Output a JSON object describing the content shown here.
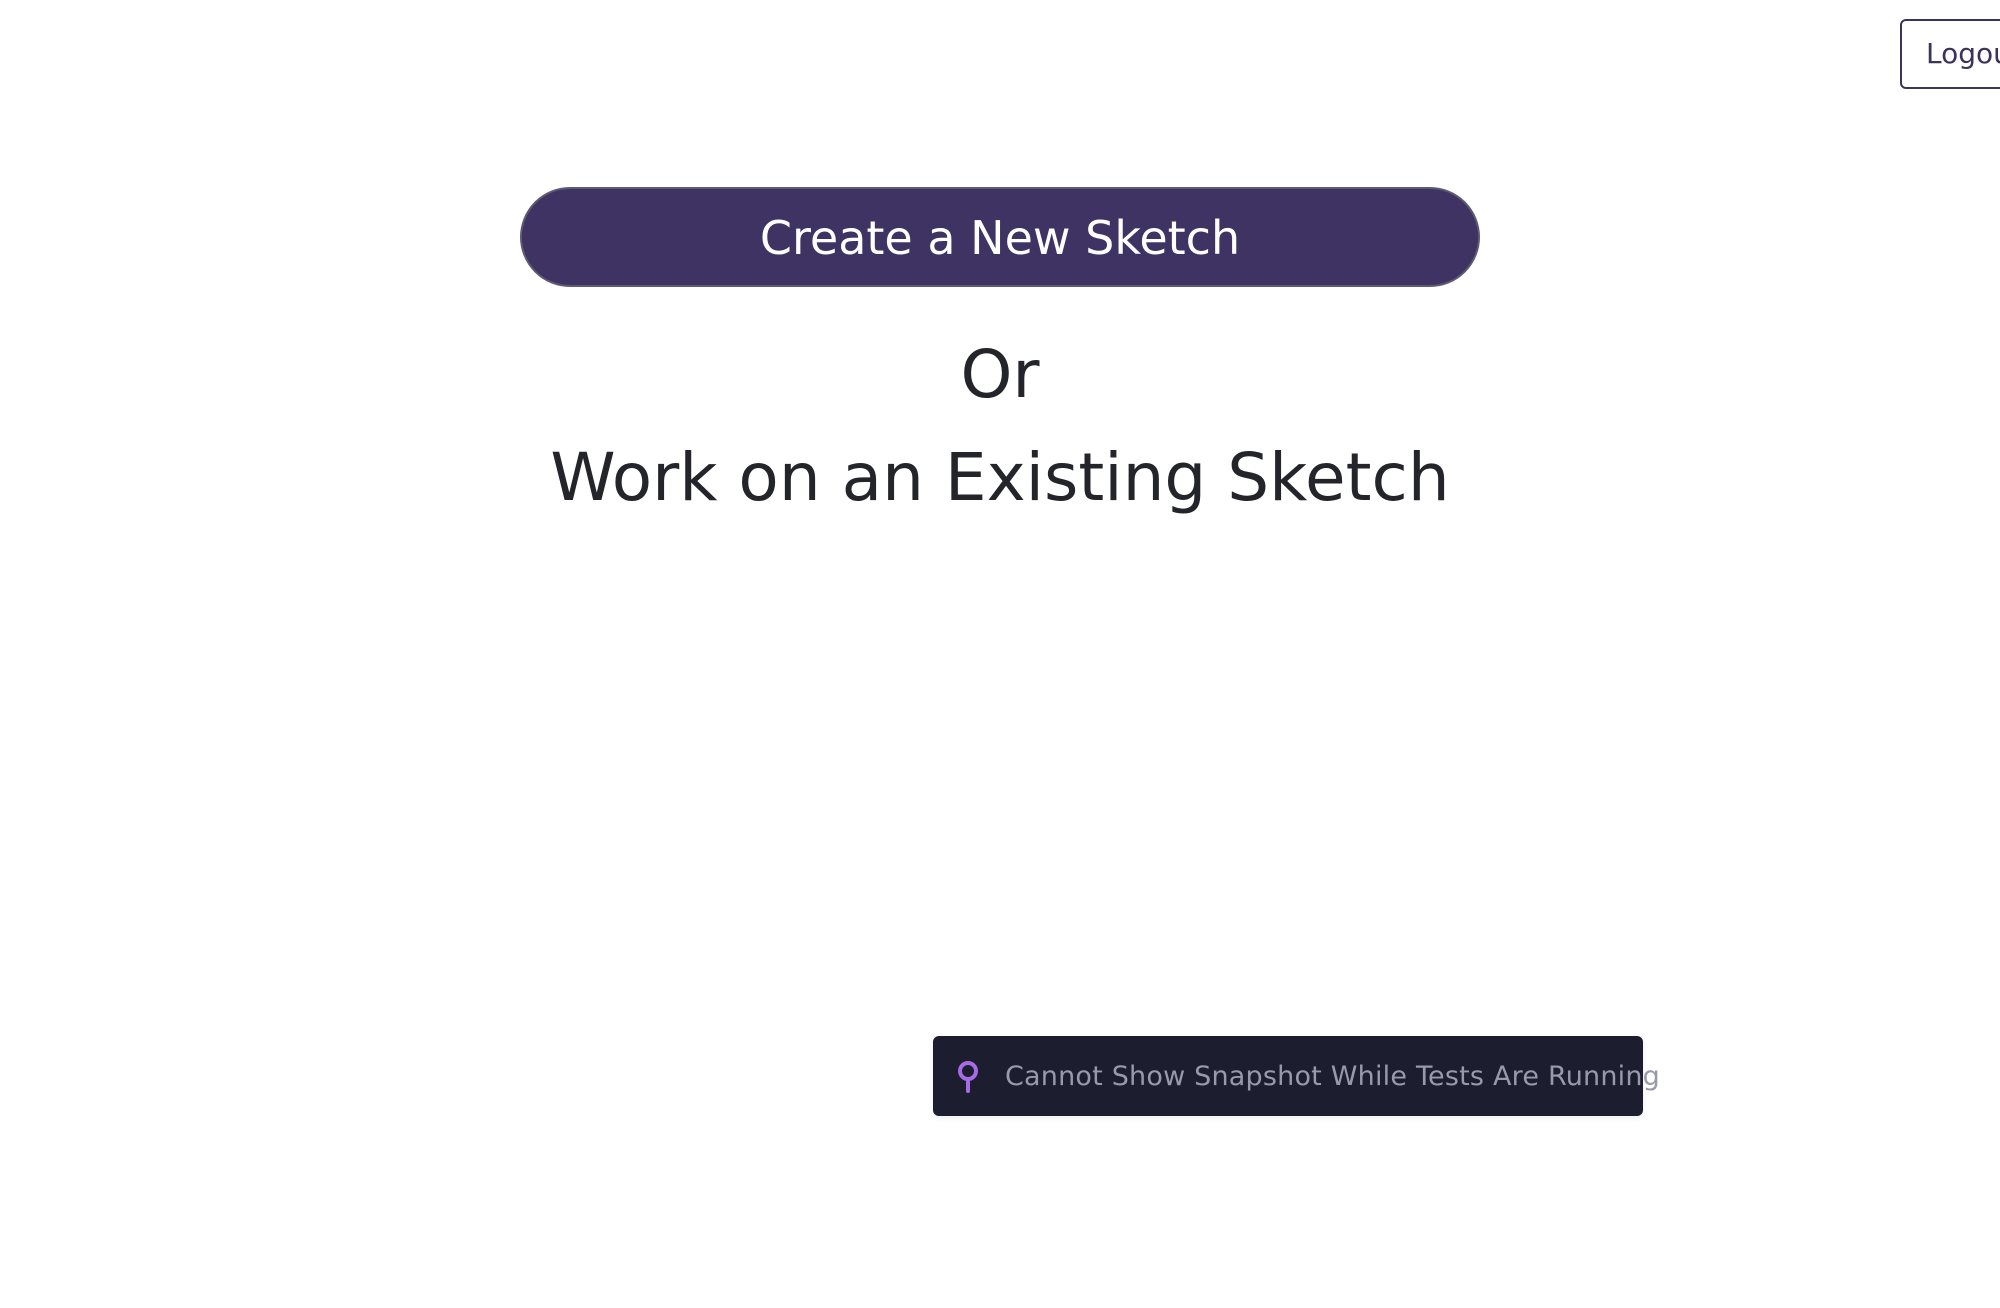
{
  "header": {
    "logout_label": "Logou"
  },
  "main": {
    "create_button_label": "Create a New Sketch",
    "or_text": "Or",
    "existing_heading": "Work on an Existing Sketch"
  },
  "toast": {
    "icon": "pin-icon",
    "message": "Cannot Show Snapshot While Tests Are Running"
  },
  "colors": {
    "primary": "#3e3363",
    "text": "#23252b",
    "toast_bg": "#1c1d2e",
    "toast_text": "#9899ad",
    "pin_icon": "#a76be6"
  }
}
